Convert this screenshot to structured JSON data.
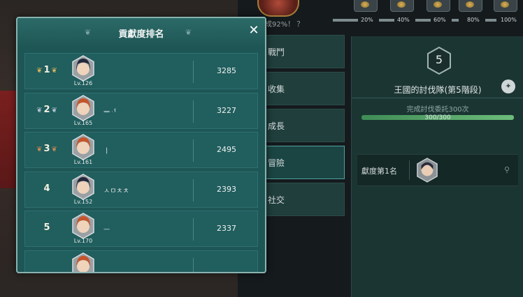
{
  "background": {
    "top_progress_text": "成92%！ ？",
    "milestones": [
      "20%",
      "40%",
      "60%",
      "80%",
      "100%"
    ],
    "tabs": [
      {
        "label": "戰鬥",
        "active": false
      },
      {
        "label": "收集",
        "active": false
      },
      {
        "label": "成長",
        "active": false
      },
      {
        "label": "冒險",
        "active": true
      },
      {
        "label": "社交",
        "active": false
      }
    ],
    "right_panel": {
      "level": "5",
      "title": "王國的討伐隊(第5階段)",
      "subtitle": "完成討伐委託300次",
      "progress_text": "300/300",
      "progress_fraction": 1.0,
      "top_contributor_label": "獻度第1名"
    }
  },
  "modal": {
    "title": "貢獻度排名",
    "close_label": "✕",
    "rows": [
      {
        "rank": "1",
        "medal": "gold",
        "level": "Lv.126",
        "name": "",
        "score": "3285",
        "avatar": "female-dark-hair"
      },
      {
        "rank": "2",
        "medal": "silver",
        "level": "Lv.165",
        "name": "ᆖᆟ",
        "score": "3227",
        "avatar": "female-red-hair"
      },
      {
        "rank": "3",
        "medal": "bronze",
        "level": "Lv.161",
        "name": "ㅣ",
        "score": "2495",
        "avatar": "female-red-hair"
      },
      {
        "rank": "4",
        "medal": "",
        "level": "Lv.152",
        "name": "ㅅㅁㅊㅊ",
        "score": "2393",
        "avatar": "female-dark-hair"
      },
      {
        "rank": "5",
        "medal": "",
        "level": "Lv.170",
        "name": "ㅡ",
        "score": "2337",
        "avatar": "female-red-hair"
      },
      {
        "rank": "",
        "medal": "",
        "level": "",
        "name": "",
        "score": "",
        "avatar": "female-red-hair"
      }
    ]
  },
  "colors": {
    "modal_bg": "#1e5656",
    "row_bg": "#215e5e",
    "gold": "#d8b45a",
    "silver": "#b6c7d4",
    "bronze": "#c98d53",
    "progress_green": "#6cbc7a"
  }
}
